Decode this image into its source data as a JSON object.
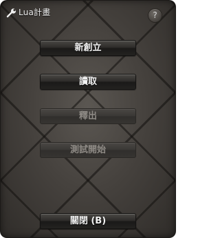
{
  "window": {
    "title": "Lua計畫",
    "title_icon": "wrench-icon",
    "help_label": "?"
  },
  "buttons": {
    "new_label": "新創立",
    "read_label": "讀取",
    "export_label": "釋出",
    "test_label": "測試開始",
    "close_label": "關閉 (B)"
  },
  "states": {
    "new_enabled": true,
    "read_enabled": true,
    "export_enabled": false,
    "test_enabled": false,
    "close_enabled": true
  },
  "colors": {
    "panel": "#3a3733",
    "button_text": "#f2f2f2",
    "disabled_text": "#8f8b86"
  }
}
